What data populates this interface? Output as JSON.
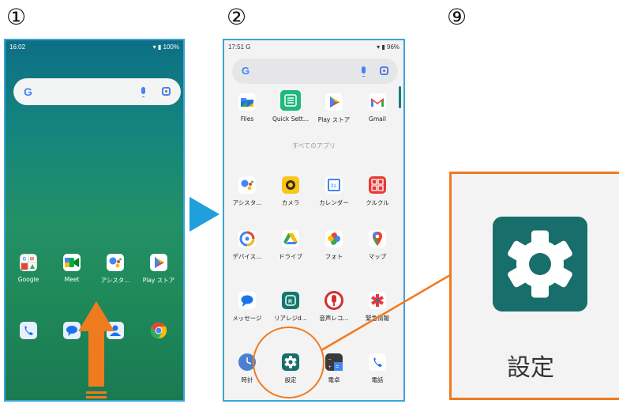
{
  "steps": {
    "s1": "①",
    "s2": "②",
    "s3": "⑨"
  },
  "phone1": {
    "status_time": "16:02",
    "status_right": "▾ ▮ 100%",
    "google_letter": "G",
    "apps": [
      {
        "label": "Google",
        "icon": "google-folder-icon"
      },
      {
        "label": "Meet",
        "icon": "meet-icon"
      },
      {
        "label": "アシスタ...",
        "icon": "assistant-icon"
      },
      {
        "label": "Play ストア",
        "icon": "play-store-icon"
      }
    ],
    "dock": [
      {
        "icon": "phone-icon"
      },
      {
        "icon": "messages-icon"
      },
      {
        "icon": "contacts-icon"
      },
      {
        "icon": "chrome-icon"
      }
    ]
  },
  "phone2": {
    "status_time": "17:51 G",
    "status_right": "▾ ▮ 96%",
    "google_letter": "G",
    "row0": [
      "Files",
      "Quick Sett...",
      "Play ストア",
      "Gmail"
    ],
    "all_apps_label": "すべてのアプリ",
    "row1": [
      "アシスタ...",
      "カメラ",
      "カレンダー",
      "クルクル"
    ],
    "row2": [
      "デバイス...",
      "ドライブ",
      "フォト",
      "マップ"
    ],
    "row3": [
      "メッセージ",
      "リアレジd...",
      "音声レコ...",
      "緊急情報"
    ],
    "row4": [
      "時計",
      "設定",
      "電卓",
      "電話"
    ]
  },
  "zoom": {
    "label": "設定",
    "icon": "settings-gear-icon"
  },
  "colors": {
    "accent_orange": "#f07a1e",
    "frame_blue": "#3ba3db",
    "settings_teal": "#186e6a"
  }
}
